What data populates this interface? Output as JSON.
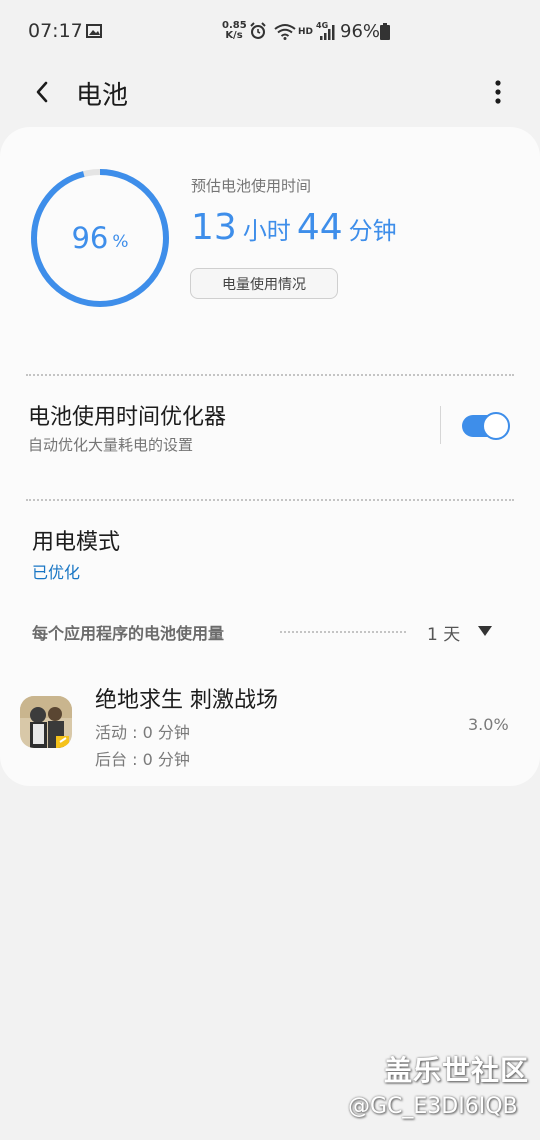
{
  "status_bar": {
    "time": "07:17",
    "net_speed_value": "0.85",
    "net_speed_unit": "K/s",
    "hd_label": "HD",
    "network_label": "4G",
    "battery_percent": "96%",
    "icons": [
      "gallery-icon",
      "alarm-icon",
      "wifi-icon",
      "signal-icon",
      "battery-icon"
    ]
  },
  "header": {
    "title": "电池",
    "back_icon": "chevron-left-icon",
    "more_icon": "more-vertical-icon"
  },
  "battery": {
    "level_number": "96",
    "level_unit": "%",
    "level_fraction": 0.96,
    "ring_color": "#3e8eea",
    "estimate_label": "预估电池使用时间",
    "estimate_hours": "13",
    "hours_unit": "小时",
    "estimate_minutes": "44",
    "minutes_unit": "分钟",
    "usage_button_label": "电量使用情况"
  },
  "optimizer": {
    "title": "电池使用时间优化器",
    "subtitle": "自动优化大量耗电的设置",
    "enabled": true
  },
  "power_mode": {
    "title": "用电模式",
    "value": "已优化"
  },
  "per_app": {
    "title": "每个应用程序的电池使用量",
    "period": "1 天",
    "apps": [
      {
        "name": "绝地求生 刺激战场",
        "active": "活动 : 0 分钟",
        "background": "后台 : 0 分钟",
        "percent": "3.0%",
        "icon": "game-app-icon"
      }
    ]
  },
  "watermark": {
    "brand": "盖乐世社区",
    "user": "@GC_E3DI6IQB"
  }
}
